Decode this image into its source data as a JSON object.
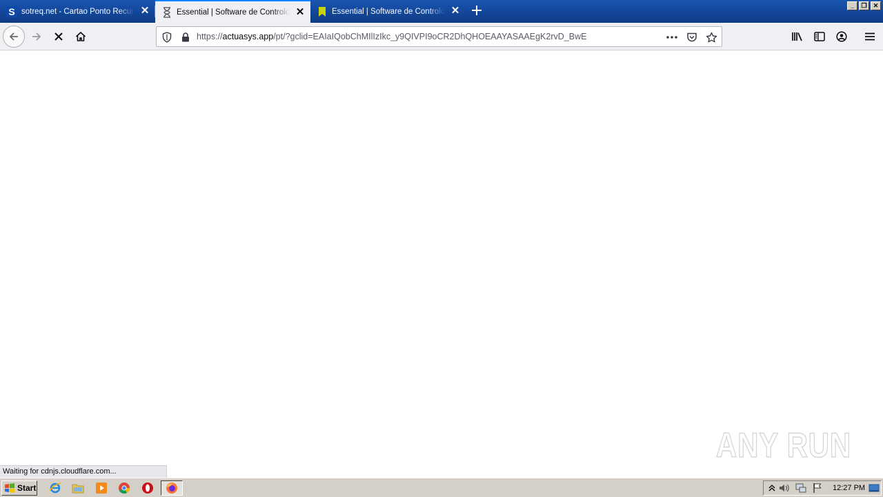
{
  "browser": {
    "tabs": [
      {
        "title": "sotreq.net - Cartao Ponto Recursos Humanos",
        "favicon": "sotreq-s-icon",
        "selected": false
      },
      {
        "title": "Essential | Software de Controlo de Assiduidade",
        "favicon": "loading-hourglass-icon",
        "selected": true
      },
      {
        "title": "Essential | Software de Controlo de Assiduidade",
        "favicon": "actuasys-logo-icon",
        "selected": false
      }
    ],
    "url": {
      "scheme": "https://",
      "host": "actuasys.app",
      "path": "/pt/?gclid=EAIaIQobChMIlIzIkc_y9QIVPI9oCR2DhQHOEAAYASAAEgK2rvD_BwE"
    },
    "status_text": "Waiting for cdnjs.cloudflare.com...",
    "accent": "#0a84ff"
  },
  "watermark": {
    "text": "ANY RUN"
  },
  "taskbar": {
    "start_label": "Start",
    "clock": "12:27 PM",
    "apps": [
      "ie-icon",
      "explorer-icon",
      "media-player-icon",
      "chrome-icon",
      "opera-icon",
      "firefox-icon"
    ]
  }
}
